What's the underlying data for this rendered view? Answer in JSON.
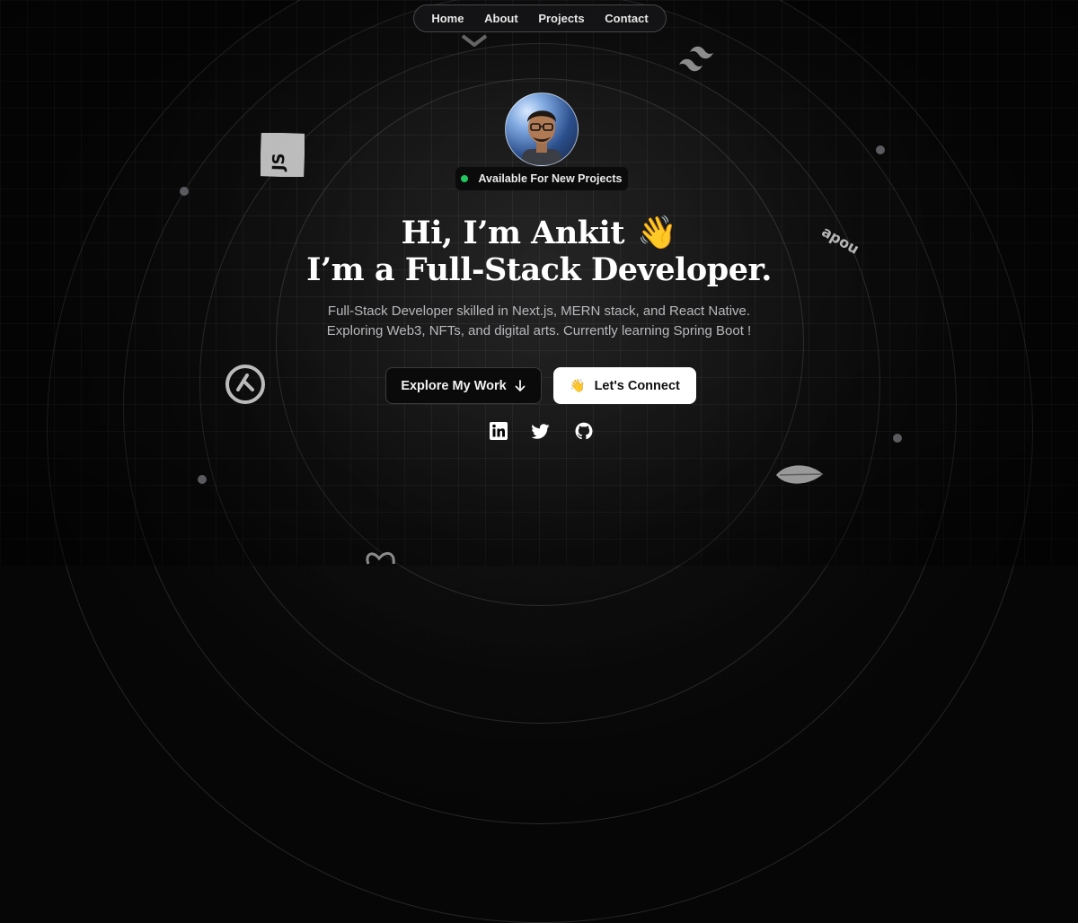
{
  "nav": {
    "items": [
      "Home",
      "About",
      "Projects",
      "Contact"
    ]
  },
  "badge": {
    "text": "Available For New Projects",
    "status_color": "#22c55e"
  },
  "hero": {
    "greeting": "Hi, I’m Ankit",
    "wave_emoji": "👋",
    "role": "I’m a Full-Stack Developer.",
    "description_line1": "Full-Stack Developer skilled in Next.js, MERN stack, and React Native.",
    "description_line2": "Exploring Web3, NFTs, and digital arts. Currently learning Spring Boot !"
  },
  "buttons": {
    "explore_label": "Explore My Work",
    "explore_icon": "arrow-down-icon",
    "connect_label": "Let's Connect",
    "connect_emoji": "👋"
  },
  "social": [
    "linkedin-icon",
    "twitter-icon",
    "github-icon"
  ],
  "floating_icons": [
    "javascript-icon",
    "tailwind-icon",
    "express-icon",
    "mongodb-icon",
    "expo-icon",
    "redux-icon"
  ],
  "colors": {
    "background": "#060606",
    "accent_text": "#ffffff",
    "light_button": "#ffffff"
  }
}
